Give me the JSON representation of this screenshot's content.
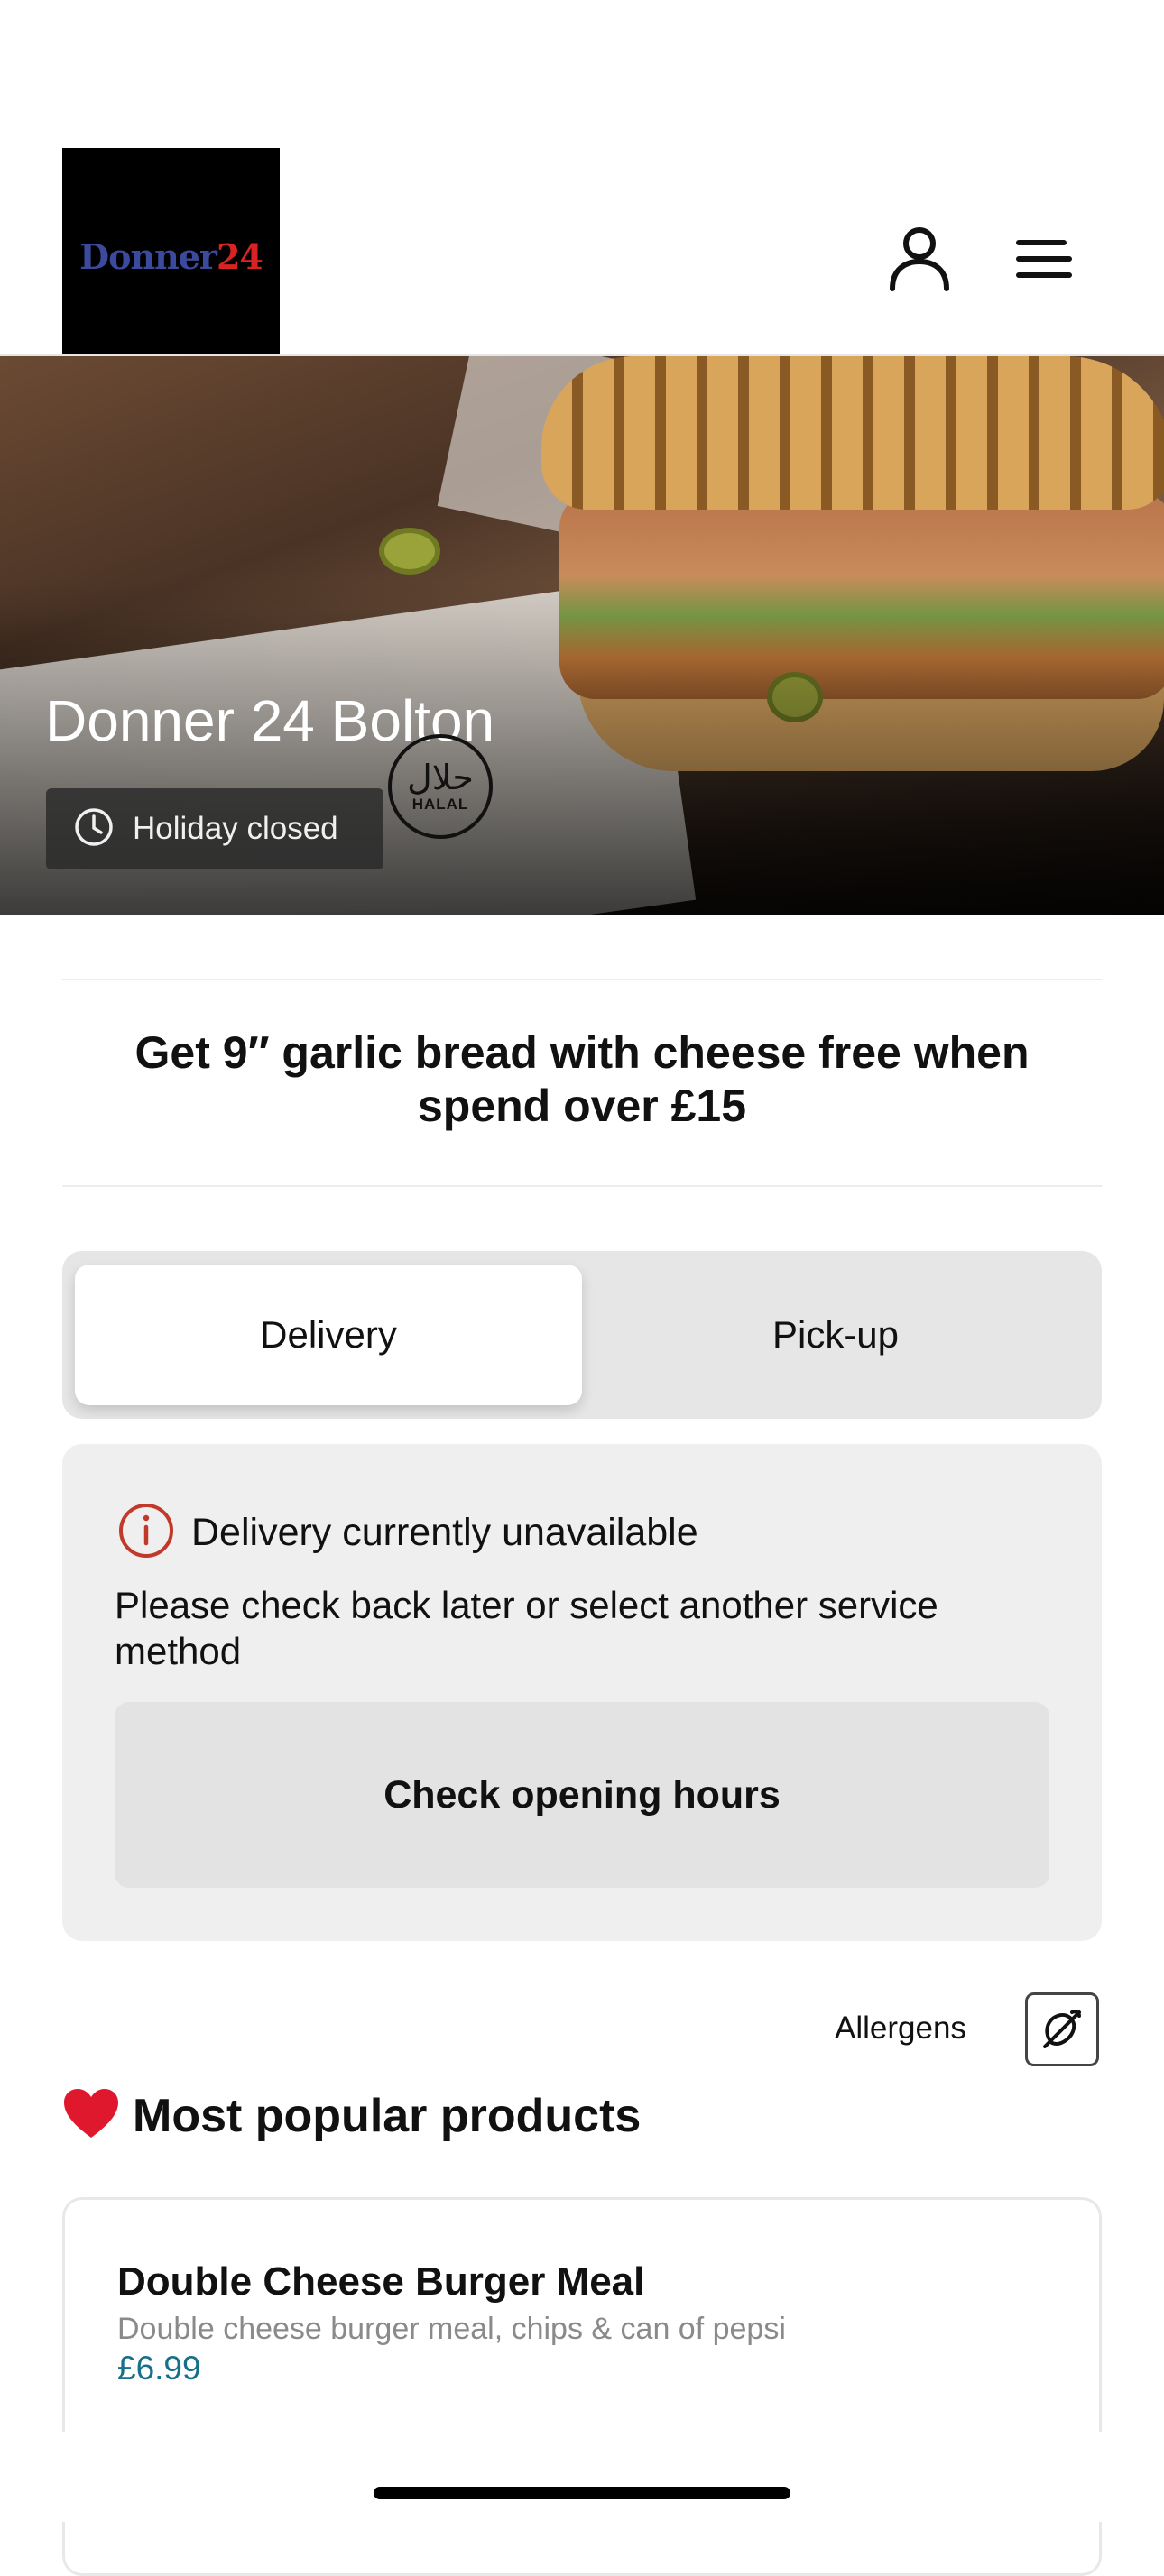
{
  "header": {
    "logo_part1": "Donner",
    "logo_part2": "24",
    "account_icon": "user-icon",
    "menu_icon": "menu-icon"
  },
  "hero": {
    "title": "Donner 24 Bolton",
    "status": "Holiday closed",
    "status_icon": "clock-icon",
    "halal_arabic": "حلال",
    "halal_label": "HALAL"
  },
  "promo": {
    "text": "Get 9″ garlic bread with cheese free when spend over £15"
  },
  "service_toggle": {
    "options": [
      "Delivery",
      "Pick-up"
    ],
    "selected": "Delivery"
  },
  "unavailable": {
    "icon": "info-icon",
    "title": "Delivery currently unavailable",
    "message": "Please check back later or select another service method",
    "button_label": "Check opening hours"
  },
  "allergens": {
    "label": "Allergens",
    "icon": "allergen-icon"
  },
  "popular": {
    "emoji": "❤️",
    "title": "Most popular products",
    "products": [
      {
        "name": "Double Cheese Burger Meal",
        "description": "Double cheese burger meal, chips & can of pepsi",
        "price": "£6.99"
      }
    ]
  },
  "colors": {
    "accent_price": "#17708a",
    "info_red": "#c0392b",
    "logo_blue": "#3c4a9e",
    "logo_red": "#d82323"
  }
}
